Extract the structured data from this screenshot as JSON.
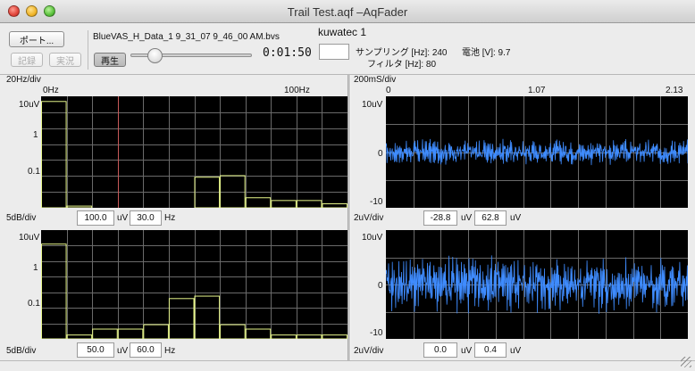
{
  "window": {
    "title": "Trail Test.aqf –AqFader"
  },
  "toolbar": {
    "port_label": "ポート...",
    "record_label": "記録",
    "realtime_label": "実況",
    "play_label": "再生",
    "file_name": "BlueVAS_H_Data_1 9_31_07 9_46_00 AM.bvs",
    "time": "0:01:50",
    "device": "kuwatec 1",
    "device_value": "",
    "sampling_label": "サンプリング [Hz]: 240",
    "filter_label": "フィルタ [Hz]: 80",
    "battery_label": "電池 [V]: 9.7",
    "playback_position": 0.16
  },
  "spectrum": {
    "scale_label": "20Hz/div",
    "x_ticks": [
      "0Hz",
      "100Hz"
    ],
    "upper": {
      "y_ticks": [
        "10uV",
        "1",
        "0.1"
      ],
      "db_label": "5dB/div",
      "top_value": "100.0",
      "top_unit": "uV",
      "freq_value": "30.0",
      "freq_unit": "Hz"
    },
    "lower": {
      "y_ticks": [
        "10uV",
        "1",
        "0.1"
      ],
      "db_label": "5dB/div",
      "top_value": "50.0",
      "top_unit": "uV",
      "freq_value": "60.0",
      "freq_unit": "Hz"
    }
  },
  "waveform": {
    "scale_label": "200mS/div",
    "x_ticks": [
      "0",
      "1.07",
      "2.13"
    ],
    "upper": {
      "y_ticks": [
        "10uV",
        "0",
        "-10"
      ],
      "scale_label": "2uV/div",
      "offset_value": "-28.8",
      "offset_unit": "uV",
      "range_value": "62.8",
      "range_unit": "uV"
    },
    "lower": {
      "y_ticks": [
        "10uV",
        "0",
        "-10"
      ],
      "scale_label": "2uV/div",
      "offset_value": "0.0",
      "offset_unit": "uV",
      "range_value": "0.4",
      "range_unit": "uV"
    }
  },
  "chart_data": [
    {
      "type": "bar",
      "title": "",
      "xlabel": "",
      "ylabel": "",
      "x_range": [
        0,
        120
      ],
      "y_scale": "log",
      "ylim": [
        0.02,
        10
      ],
      "bin_width_hz": 10,
      "values": [
        7.5,
        0.022,
        0.02,
        0.02,
        0.02,
        0.02,
        0.11,
        0.12,
        0.035,
        0.03,
        0.03,
        0.025,
        0.025,
        0.02
      ],
      "marker_hz": 30,
      "bar_color": "#e6f58a",
      "marker_color": "#c85a5a",
      "grid": true
    },
    {
      "type": "bar",
      "title": "",
      "xlabel": "",
      "ylabel": "",
      "x_range": [
        0,
        120
      ],
      "y_scale": "log",
      "ylim": [
        0.02,
        10
      ],
      "bin_width_hz": 10,
      "values": [
        4.5,
        0.025,
        0.035,
        0.035,
        0.045,
        0.2,
        0.23,
        0.045,
        0.035,
        0.025,
        0.025,
        0.025
      ],
      "bar_color": "#e6f58a",
      "grid": true
    },
    {
      "type": "line",
      "title": "",
      "xlabel": "",
      "ylabel": "",
      "x_range": [
        0,
        2.13
      ],
      "ylim": [
        -10,
        10
      ],
      "amplitude_uV": 2.0,
      "line_color": "#3f8cff",
      "grid": true
    },
    {
      "type": "line",
      "title": "",
      "xlabel": "",
      "ylabel": "",
      "x_range": [
        0,
        2.13
      ],
      "ylim": [
        -10,
        10
      ],
      "amplitude_uV": 4.5,
      "line_color": "#3f8cff",
      "grid": true
    }
  ]
}
